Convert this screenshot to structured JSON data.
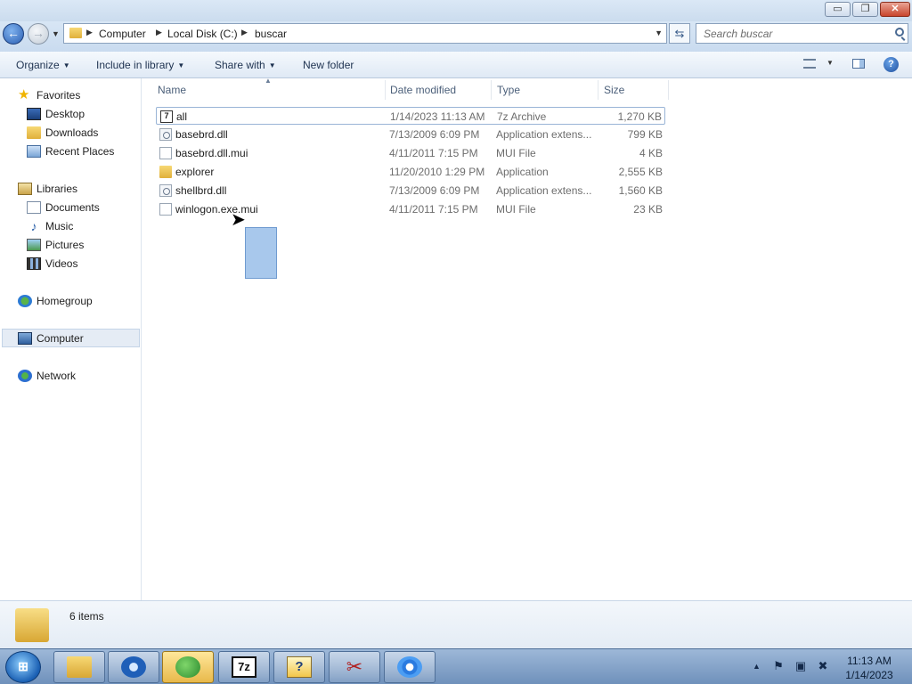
{
  "window": {
    "min_symbol": "▭",
    "max_symbol": "❐",
    "close_symbol": "✕"
  },
  "address": {
    "crumbs": [
      "Computer",
      "Local Disk (C:)",
      "buscar"
    ]
  },
  "search": {
    "placeholder": "Search buscar"
  },
  "toolbar": {
    "organize": "Organize",
    "include_in_library": "Include in library",
    "share_with": "Share with",
    "new_folder": "New folder"
  },
  "nav": {
    "favorites": "Favorites",
    "desktop": "Desktop",
    "downloads": "Downloads",
    "recent_places": "Recent Places",
    "libraries": "Libraries",
    "documents": "Documents",
    "music": "Music",
    "pictures": "Pictures",
    "videos": "Videos",
    "homegroup": "Homegroup",
    "computer": "Computer",
    "network": "Network"
  },
  "columns": {
    "name": "Name",
    "date_modified": "Date modified",
    "type": "Type",
    "size": "Size"
  },
  "files": [
    {
      "name": "all",
      "date": "1/14/2023 11:13 AM",
      "type": "7z Archive",
      "size": "1,270 KB",
      "icon": "7z-archive-icon"
    },
    {
      "name": "basebrd.dll",
      "date": "7/13/2009 6:09 PM",
      "type": "Application extens...",
      "size": "799 KB",
      "icon": "dll-file-icon"
    },
    {
      "name": "basebrd.dll.mui",
      "date": "4/11/2011 7:15 PM",
      "type": "MUI File",
      "size": "4 KB",
      "icon": "blank-file-icon"
    },
    {
      "name": "explorer",
      "date": "11/20/2010 1:29 PM",
      "type": "Application",
      "size": "2,555 KB",
      "icon": "application-icon"
    },
    {
      "name": "shellbrd.dll",
      "date": "7/13/2009 6:09 PM",
      "type": "Application extens...",
      "size": "1,560 KB",
      "icon": "dll-file-icon"
    },
    {
      "name": "winlogon.exe.mui",
      "date": "4/11/2011 7:15 PM",
      "type": "MUI File",
      "size": "23 KB",
      "icon": "blank-file-icon"
    }
  ],
  "details": {
    "item_count": "6 items"
  },
  "taskbar": {
    "sevenzip_label": "7z",
    "help_label": "?",
    "clock_time": "11:13 AM",
    "clock_date": "1/14/2023"
  },
  "colors": {
    "selection": "#a8c8ec",
    "accent": "#1e3250"
  }
}
